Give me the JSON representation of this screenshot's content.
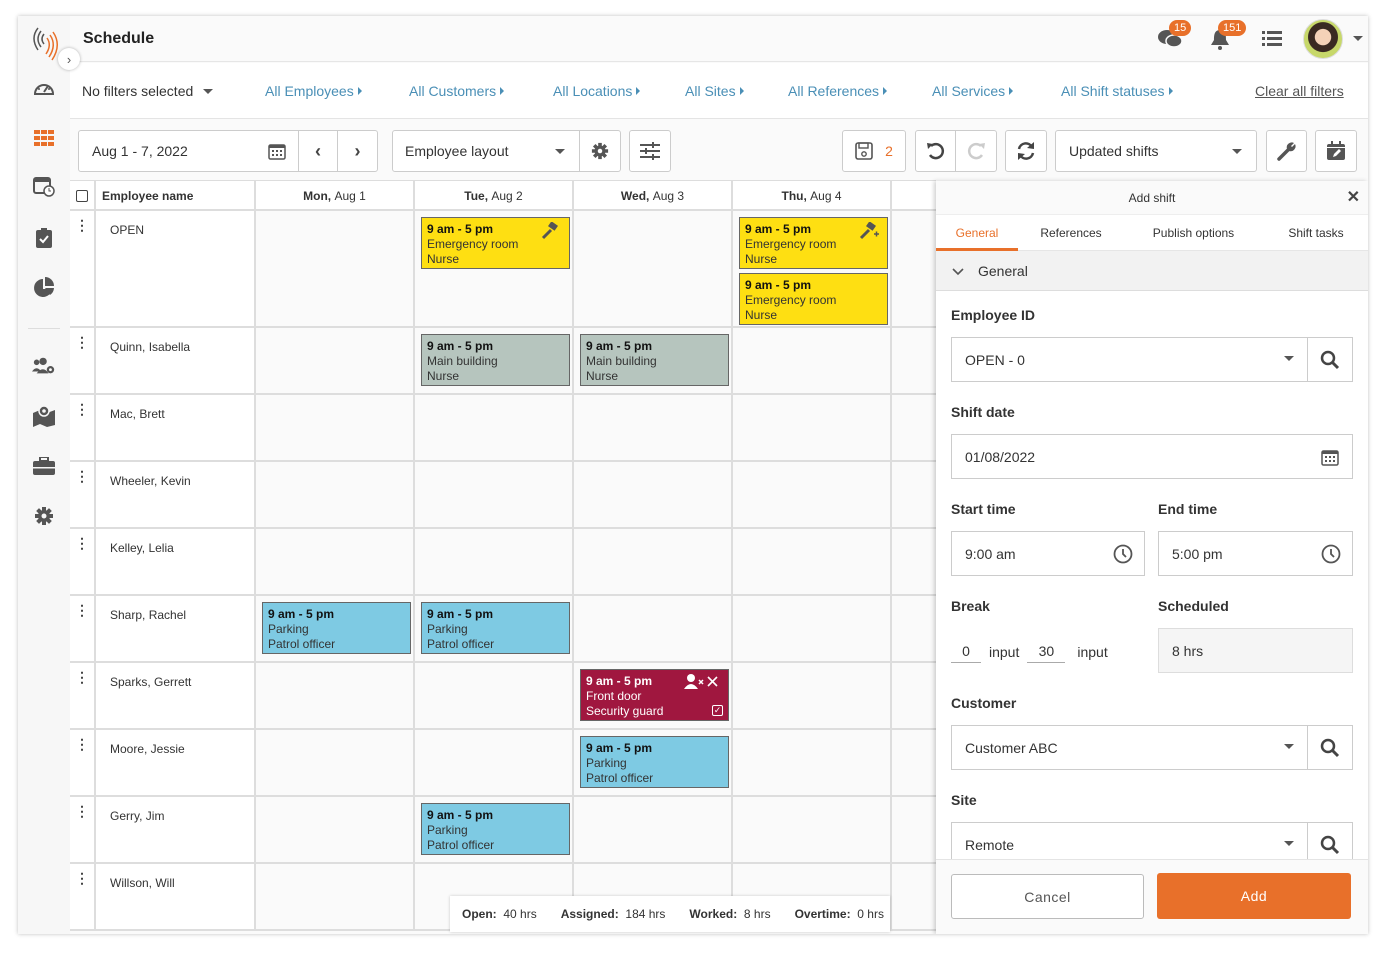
{
  "app": {
    "title": "Schedule"
  },
  "header": {
    "chat_badge": "15",
    "notif_badge": "151"
  },
  "filters": {
    "no_filters": "No filters selected",
    "links": [
      "All Employees",
      "All Customers",
      "All Locations",
      "All Sites",
      "All References",
      "All Services",
      "All Shift statuses"
    ],
    "clear": "Clear all filters"
  },
  "toolbar": {
    "date_range": "Aug 1 - 7, 2022",
    "layout": "Employee layout",
    "save_count": "2",
    "view_filter": "Updated shifts"
  },
  "grid": {
    "col_employee": "Employee name",
    "days": [
      {
        "dow": "Mon,",
        "date": "Aug 1"
      },
      {
        "dow": "Tue,",
        "date": "Aug 2"
      },
      {
        "dow": "Wed,",
        "date": "Aug 3"
      },
      {
        "dow": "Thu,",
        "date": "Aug 4"
      }
    ],
    "employees": [
      "OPEN",
      "Quinn, Isabella",
      "Mac, Brett",
      "Wheeler, Kevin",
      "Kelley, Lelia",
      "Sharp, Rachel",
      "Sparks, Gerrett",
      "Moore, Jessie",
      "Gerry, Jim",
      "Willson, Will"
    ],
    "shifts": [
      {
        "row": 0,
        "day": 1,
        "time": "9 am - 5 pm",
        "place": "Emergency room",
        "role": "Nurse",
        "color": "#fedf12",
        "icon": "gavel-icon"
      },
      {
        "row": 0,
        "day": 3,
        "time": "9 am - 5 pm",
        "place": "Emergency room",
        "role": "Nurse",
        "color": "#fedf12",
        "icon": "gavel-plus-icon"
      },
      {
        "row": 0,
        "day": 3,
        "time": "9 am - 5 pm",
        "place": "Emergency room",
        "role": "Nurse",
        "color": "#fedf12"
      },
      {
        "row": 1,
        "day": 1,
        "time": "9 am - 5 pm",
        "place": "Main building",
        "role": "Nurse",
        "color": "#b6c5be"
      },
      {
        "row": 1,
        "day": 2,
        "time": "9 am - 5 pm",
        "place": "Main building",
        "role": "Nurse",
        "color": "#b6c5be"
      },
      {
        "row": 5,
        "day": 0,
        "time": "9 am - 5 pm",
        "place": "Parking",
        "role": "Patrol officer",
        "color": "#7ecae3"
      },
      {
        "row": 5,
        "day": 1,
        "time": "9 am - 5 pm",
        "place": "Parking",
        "role": "Patrol officer",
        "color": "#7ecae3"
      },
      {
        "row": 6,
        "day": 2,
        "time": "9 am - 5 pm",
        "place": "Front door",
        "role": "Security guard",
        "color": "#a0173f",
        "icon": "user-remove-icon"
      },
      {
        "row": 7,
        "day": 2,
        "time": "9 am - 5 pm",
        "place": "Parking",
        "role": "Patrol officer",
        "color": "#7ecae3"
      },
      {
        "row": 8,
        "day": 1,
        "time": "9 am - 5 pm",
        "place": "Parking",
        "role": "Patrol officer",
        "color": "#7ecae3"
      }
    ]
  },
  "totals": {
    "open_label": "Open:",
    "open": "40 hrs",
    "assigned_label": "Assigned:",
    "assigned": "184 hrs",
    "worked_label": "Worked:",
    "worked": "8 hrs",
    "overtime_label": "Overtime:",
    "overtime": "0 hrs"
  },
  "panel": {
    "title": "Add shift",
    "tabs": [
      "General",
      "References",
      "Publish options",
      "Shift tasks"
    ],
    "section": "General",
    "employee_id_label": "Employee ID",
    "employee_id": "OPEN - 0",
    "shift_date_label": "Shift date",
    "shift_date": "01/08/2022",
    "start_label": "Start time",
    "start": "9:00 am",
    "end_label": "End time",
    "end": "5:00 pm",
    "break_label": "Break",
    "break_hours": "0",
    "break_hours_unit": "input",
    "break_minutes": "30",
    "break_minutes_unit": "input",
    "scheduled_label": "Scheduled",
    "scheduled": "8 hrs",
    "customer_label": "Customer",
    "customer": "Customer ABC",
    "site_label": "Site",
    "site": "Remote",
    "cancel": "Cancel",
    "add": "Add"
  },
  "colors": {
    "accent": "#e8702a",
    "link": "#4a8fb6"
  }
}
